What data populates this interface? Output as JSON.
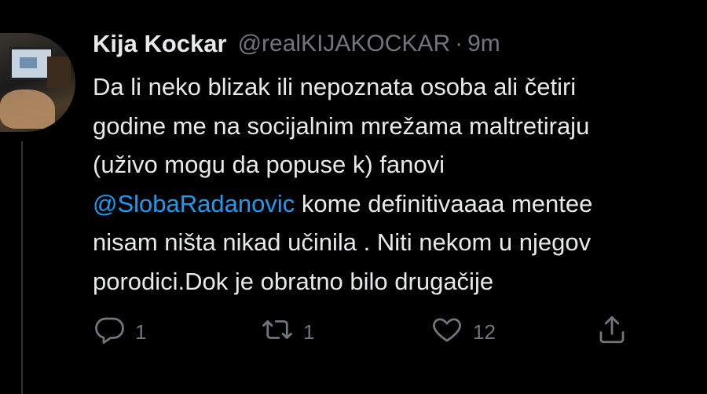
{
  "tweet": {
    "display_name": "Kija Kockar",
    "handle": "@realKIJAKOCKAR",
    "separator": "·",
    "time": "9m",
    "lines": [
      "Da li neko blizak ili nepoznata osoba ali četiri",
      "godine me na socijalnim mrežama maltretiraju",
      "(uživo mogu da popuse k) fanovi",
      "nisam ništa nikad učinila . Niti nekom u njegov",
      "porodici.Dok  je obratno bilo drugačije"
    ],
    "mention": "@SlobaRadanovic",
    "mention_line_rest": " kome definitivaaaa mentee"
  },
  "actions": {
    "reply": {
      "icon": "reply-icon",
      "count": "1"
    },
    "retweet": {
      "icon": "retweet-icon",
      "count": "1"
    },
    "like": {
      "icon": "heart-icon",
      "count": "12"
    },
    "share": {
      "icon": "share-icon"
    }
  },
  "colors": {
    "background": "#000000",
    "text": "#e7e9ea",
    "muted": "#71767b",
    "mention": "#1d9bf0"
  }
}
